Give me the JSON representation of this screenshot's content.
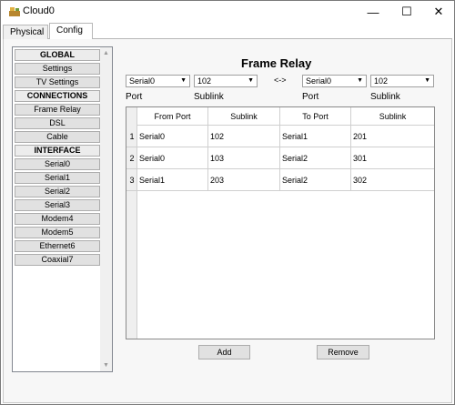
{
  "window": {
    "title": "Cloud0"
  },
  "titlebar_buttons": {
    "minimize": "—",
    "maximize": "☐",
    "close": "✕"
  },
  "tabs": [
    {
      "label": "Physical"
    },
    {
      "label": "Config"
    }
  ],
  "sidebar": {
    "items": [
      {
        "label": "GLOBAL",
        "header": true
      },
      {
        "label": "Settings"
      },
      {
        "label": "TV Settings"
      },
      {
        "label": "CONNECTIONS",
        "header": true
      },
      {
        "label": "Frame Relay"
      },
      {
        "label": "DSL"
      },
      {
        "label": "Cable"
      },
      {
        "label": "INTERFACE",
        "header": true
      },
      {
        "label": "Serial0"
      },
      {
        "label": "Serial1"
      },
      {
        "label": "Serial2"
      },
      {
        "label": "Serial3"
      },
      {
        "label": "Modem4"
      },
      {
        "label": "Modem5"
      },
      {
        "label": "Ethernet6"
      },
      {
        "label": "Coaxial7"
      }
    ]
  },
  "frame_relay": {
    "title": "Frame Relay",
    "port_left": "Serial0",
    "sublink_left": "102",
    "arrow": "<->",
    "port_right": "Serial0",
    "sublink_right": "102",
    "label_port": "Port",
    "label_sublink": "Sublink",
    "table": {
      "headers": [
        "From Port",
        "Sublink",
        "To Port",
        "Sublink"
      ],
      "rows": [
        {
          "num": "1",
          "from": "Serial0",
          "from_sub": "102",
          "to": "Serial1",
          "to_sub": "201"
        },
        {
          "num": "2",
          "from": "Serial0",
          "from_sub": "103",
          "to": "Serial2",
          "to_sub": "301"
        },
        {
          "num": "3",
          "from": "Serial1",
          "from_sub": "203",
          "to": "Serial2",
          "to_sub": "302"
        }
      ]
    },
    "add_label": "Add",
    "remove_label": "Remove"
  }
}
